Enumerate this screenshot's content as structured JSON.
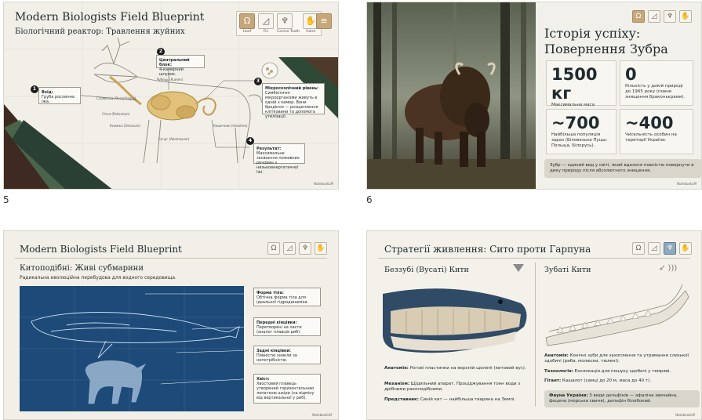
{
  "grid": {
    "slide5": {
      "number": "5",
      "title": "Modern Biologists Field Blueprint",
      "subtitle": "Біологічний реактор: Травлення жуйних",
      "icons": [
        {
          "label": "Hoof",
          "icon": "hoof-icon"
        },
        {
          "label": "Fin",
          "icon": "fin-icon"
        },
        {
          "label": "Canine Tooth",
          "icon": "tooth-icon"
        },
        {
          "label": "Hand",
          "icon": "hand-icon"
        }
      ],
      "callouts": [
        {
          "n": "1",
          "title": "Вхід:",
          "text": "Груба рослинна їжа."
        },
        {
          "n": "2",
          "title": "Центральний блок:",
          "text": "4-камерний шлунок."
        },
        {
          "n": "3",
          "title": "Мікроскопічний рівень:",
          "text": "Симбіотичні мікроорганізми живуть в одній з камер. Вони бродіння — розщеплення клітковини та допомога утилізації."
        },
        {
          "n": "4",
          "title": "Результат:",
          "text": "Максимальне засвоєння поживних речовин з низькоенергетичної їжі."
        }
      ],
      "diagram_labels": [
        "Рубець (Rumen)",
        "Сітка (Reticulum)",
        "Книжка (Omasum)",
        "Сичуг (Abomasum)",
        "Кишечник (Intestine)",
        "Стравохід (Oesophagus)"
      ],
      "footer": "NotebookLM"
    },
    "slide6": {
      "number": "6",
      "title": "Історія успіху: Повернення Зубра",
      "stats": [
        {
          "value": "1500 кг",
          "label": "Максимальна маса самця."
        },
        {
          "value": "0",
          "label": "Кількість у дикій природі до 1965 року (повне знищення браконьєрами)."
        },
        {
          "value": "~700",
          "label": "Найбільша популяція зараз (Біловезька Пуща: Польща, Білорусь)."
        },
        {
          "value": "~400",
          "label": "Чисельність особин на території України."
        }
      ],
      "note": "Зубр — єдиний вид у світі, який вдалося повністю повернути в дику природу після абсолютного знищення.",
      "footer": "NotebookLM"
    },
    "slide7": {
      "title": "Modern Biologists Field Blueprint",
      "subtitle": "Китоподібні: Живі субмарини",
      "lead": "Радикальна еволюційна перебудова для водного середовища.",
      "callouts": [
        {
          "title": "Форма тіла:",
          "text": "Обтічна форма тіла для ідеальної гідродинаміки."
        },
        {
          "title": "Передні кінцівки:",
          "text": "Перетворені на ласти (аналог плавців риб)."
        },
        {
          "title": "Задні кінцівки:",
          "text": "Повністю зникли за непотрібністю."
        },
        {
          "title": "Хвіст:",
          "text": "Хвостовий плавець утворений горизонтальною лопаткою шкіри (на відміну від вертикальної у риб)."
        }
      ],
      "footer": "NotebookLM"
    },
    "slide8": {
      "title": "Стратегії живлення: Сито проти Гарпуна",
      "left": {
        "heading": "Беззубі (Вусаті) Кити",
        "rows": [
          {
            "k": "Анатомія:",
            "v": "Рогові пластинки на верхній щелепі (китовий вус)."
          },
          {
            "k": "Механізм:",
            "v": "Щідильний апарат. Проціджування тонн води з дрібними ракоподібними."
          },
          {
            "k": "Представник:",
            "v": "Синій кит — найбільша тварина на Землі."
          }
        ]
      },
      "right": {
        "heading": "Зубаті Кити",
        "rows": [
          {
            "k": "Анатомія:",
            "v": "Конічні зуби для захоплення та утримання слизької здобичі (риба, молюски, тюлені)."
          },
          {
            "k": "Технологія:",
            "v": "Ехолокація для пошуку здобичі у темряві."
          },
          {
            "k": "Гігант:",
            "v": "Кашалот (самці до 20 м, маса до 40 т)."
          }
        ],
        "fauna_k": "Фауна України:",
        "fauna_v": "3 види дельфінів — афаліна звичайна, фоцена (морська свиня), дельфін білобокий."
      },
      "footer": "NotebookLM"
    }
  }
}
